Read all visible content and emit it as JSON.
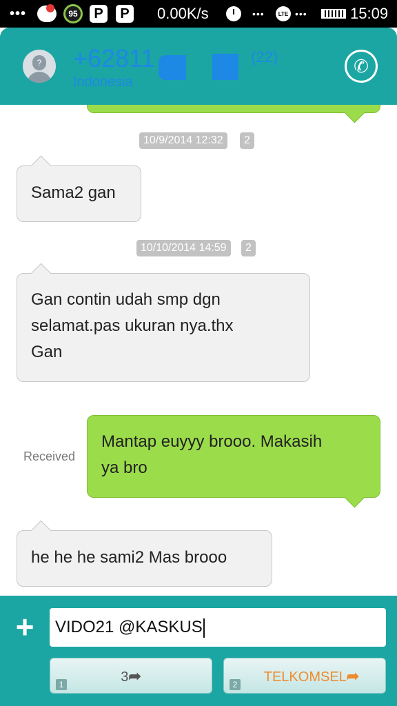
{
  "status_bar": {
    "dots": "•••",
    "badge_95": "95",
    "p_icon": "P",
    "speed": "0.00K/s",
    "lte": "LTE",
    "sig1": "•••",
    "sig2": "•••",
    "time": "15:09"
  },
  "header": {
    "number": "+62811",
    "country": "Indonesia",
    "count": "(22)",
    "call_icon": "✆"
  },
  "messages": [
    {
      "type": "timestamp",
      "time": "10/9/2014 12:32",
      "sim": "2"
    },
    {
      "type": "incoming",
      "text": "Sama2 gan"
    },
    {
      "type": "timestamp",
      "time": "10/10/2014 14:59",
      "sim": "2"
    },
    {
      "type": "incoming",
      "lines": [
        "Gan contin udah smp dgn",
        "selamat.pas ukuran nya.thx",
        "Gan"
      ]
    },
    {
      "type": "outgoing",
      "status": "Received",
      "lines": [
        "Mantap euyyy brooo. Makasih",
        "ya bro"
      ]
    },
    {
      "type": "incoming",
      "text": "he he he sami2 Mas brooo"
    }
  ],
  "composer": {
    "plus": "+",
    "input_value": "VIDO21 @KASKUS",
    "send_buttons": [
      {
        "sim": "1",
        "label": "3",
        "arrow": "➦"
      },
      {
        "sim": "2",
        "label": "TELKOMSEL",
        "arrow": "➦"
      }
    ]
  },
  "colors": {
    "header_teal": "#1ba6a3",
    "outgoing_green": "#9bdc4a",
    "incoming_gray": "#f1f1f1",
    "link_blue": "#1e88e5",
    "telkomsel_orange": "#f08a2c"
  }
}
